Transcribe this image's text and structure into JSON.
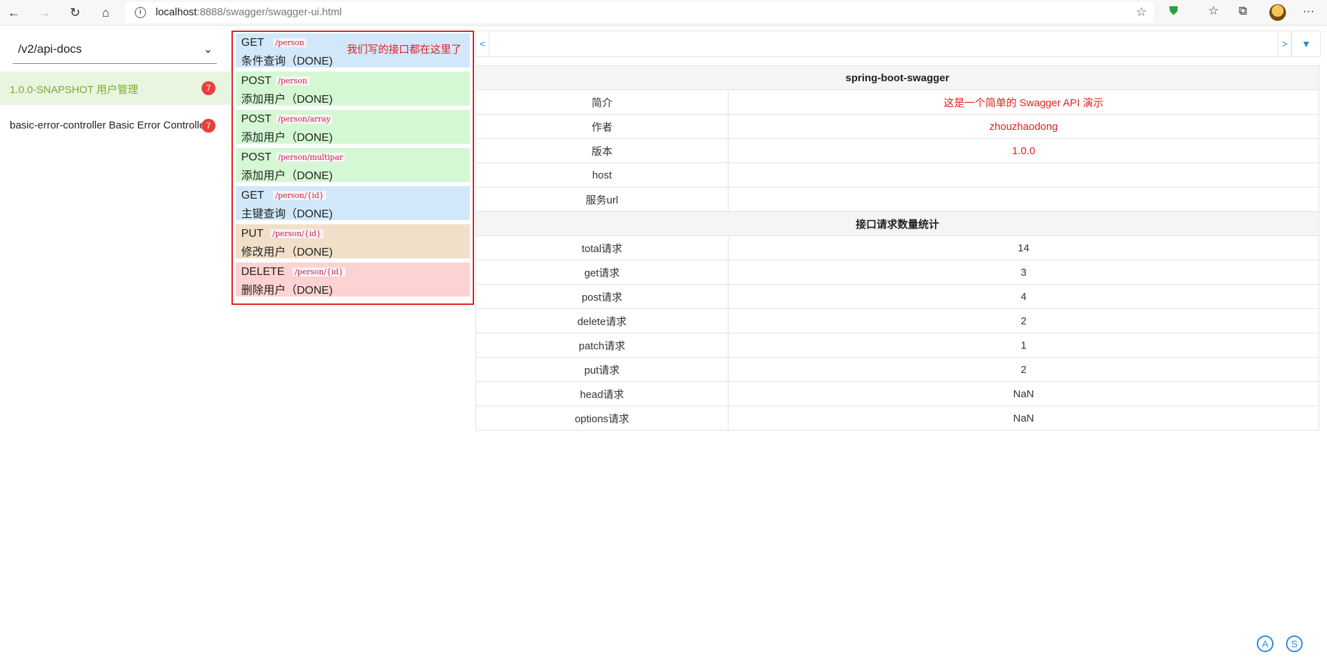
{
  "browser": {
    "url_host": "localhost",
    "url_rest": ":8888/swagger/swagger-ui.html"
  },
  "sidebar": {
    "api_select_value": "/v2/api-docs",
    "groups": [
      {
        "label": "1.0.0-SNAPSHOT   用户管理",
        "badge": "7"
      },
      {
        "label": "basic-error-controller   Basic Error Controller",
        "badge": "7"
      }
    ]
  },
  "endpoints": [
    {
      "method": "GET",
      "path": "/person",
      "summary": "条件查询（DONE)",
      "color": "#d1e8fb"
    },
    {
      "method": "POST",
      "path": "/person",
      "summary": "添加用户（DONE)",
      "color": "#d4f8d4"
    },
    {
      "method": "POST",
      "path": "/person/array",
      "summary": "添加用户（DONE)",
      "color": "#d4f8d4"
    },
    {
      "method": "POST",
      "path": "/person/multipar",
      "summary": "添加用户（DONE)",
      "color": "#d4f8d4"
    },
    {
      "method": "GET",
      "path": "/person/{id}",
      "summary": "主键查询（DONE)",
      "color": "#d1e8fb"
    },
    {
      "method": "PUT",
      "path": "/person/{id}",
      "summary": "修改用户（DONE)",
      "color": "#f2dfc9"
    },
    {
      "method": "DELETE",
      "path": "/person/{id}",
      "summary": "删除用户（DONE)",
      "color": "#fdd2d2"
    }
  ],
  "annotation": "我们写的接口都在这里了",
  "pager": {
    "prev": "<",
    "next": ">",
    "menu": "▼"
  },
  "info": {
    "title": "spring-boot-swagger",
    "rows": [
      {
        "key": "简介",
        "value": "这是一个简单的 Swagger API 演示"
      },
      {
        "key": "作者",
        "value": "zhouzhaodong"
      },
      {
        "key": "版本",
        "value": "1.0.0"
      },
      {
        "key": "host",
        "value": ""
      },
      {
        "key": "服务url",
        "value": ""
      }
    ],
    "stats_title": "接口请求数量统计",
    "stats": [
      {
        "key": "total请求",
        "value": "14"
      },
      {
        "key": "get请求",
        "value": "3"
      },
      {
        "key": "post请求",
        "value": "4"
      },
      {
        "key": "delete请求",
        "value": "2"
      },
      {
        "key": "patch请求",
        "value": "1"
      },
      {
        "key": "put请求",
        "value": "2"
      },
      {
        "key": "head请求",
        "value": "NaN"
      },
      {
        "key": "options请求",
        "value": "NaN"
      }
    ]
  },
  "fab": {
    "a": "A",
    "s": "S"
  },
  "icons": {
    "back": "back-arrow-icon",
    "forward": "forward-arrow-icon",
    "refresh": "refresh-icon",
    "home": "home-icon",
    "info": "info-icon",
    "star": "star-icon",
    "shield": "shield-icon",
    "favorites": "favorites-icon",
    "collections": "collections-icon",
    "more": "more-icon"
  },
  "colors": {
    "accent": "#7aab2c",
    "highlight_red": "#e02020",
    "link_blue": "#2a8ad8"
  }
}
